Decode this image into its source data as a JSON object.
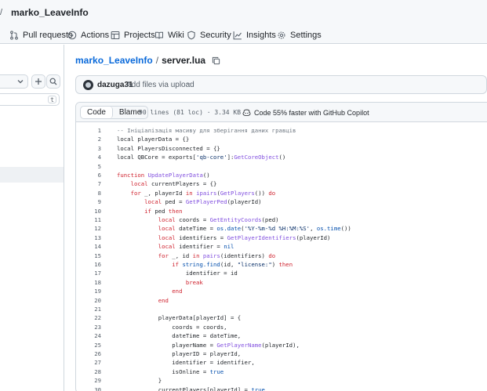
{
  "header": {
    "owner_sep": "/",
    "repo_name": "marko_LeaveInfo"
  },
  "nav": {
    "tabs": [
      {
        "label": "Pull requests",
        "icon": "pull-request-icon"
      },
      {
        "label": "Actions",
        "icon": "play-icon"
      },
      {
        "label": "Projects",
        "icon": "table-icon"
      },
      {
        "label": "Wiki",
        "icon": "book-icon"
      },
      {
        "label": "Security",
        "icon": "shield-icon"
      },
      {
        "label": "Insights",
        "icon": "graph-icon"
      },
      {
        "label": "Settings",
        "icon": "gear-icon"
      }
    ]
  },
  "sidebar": {
    "filter_shortcut": "t"
  },
  "breadcrumb": {
    "repo": "marko_LeaveInfo",
    "sep": "/",
    "file": "server.lua"
  },
  "commit": {
    "author": "dazuga31",
    "message": "Add files via upload",
    "more": "···"
  },
  "file": {
    "code_tab": "Code",
    "blame_tab": "Blame",
    "info": "90 lines (81 loc) · 3.34 KB",
    "copilot": "Code 55% faster with GitHub Copilot"
  },
  "code_lines": [
    {
      "n": "1",
      "segs": [
        [
          "c",
          "-- Ініціалізація масиву для зберігання даних гравців"
        ]
      ]
    },
    {
      "n": "2",
      "segs": [
        [
          "",
          "local playerData = {}"
        ]
      ]
    },
    {
      "n": "3",
      "segs": [
        [
          "",
          "local PlayersDisconnected = {}"
        ]
      ]
    },
    {
      "n": "4",
      "segs": [
        [
          "",
          "local QBCore = exports["
        ],
        [
          "s",
          "'qb-core'"
        ],
        [
          "",
          "]:"
        ],
        [
          "f",
          "GetCoreObject"
        ],
        [
          "",
          "()"
        ]
      ]
    },
    {
      "n": "5",
      "segs": []
    },
    {
      "n": "6",
      "segs": [
        [
          "k",
          "function"
        ],
        [
          "",
          " "
        ],
        [
          "f",
          "UpdatePlayerData"
        ],
        [
          "",
          "()"
        ]
      ]
    },
    {
      "n": "7",
      "segs": [
        [
          "k",
          "    local"
        ],
        [
          "",
          " currentPlayers = {}"
        ]
      ]
    },
    {
      "n": "8",
      "segs": [
        [
          "k",
          "    for"
        ],
        [
          "",
          " _, playerId "
        ],
        [
          "k",
          "in"
        ],
        [
          "",
          " "
        ],
        [
          "f",
          "ipairs"
        ],
        [
          "",
          "("
        ],
        [
          "f",
          "GetPlayers"
        ],
        [
          "",
          "()) "
        ],
        [
          "k",
          "do"
        ]
      ]
    },
    {
      "n": "9",
      "segs": [
        [
          "k",
          "        local"
        ],
        [
          "",
          " ped = "
        ],
        [
          "f",
          "GetPlayerPed"
        ],
        [
          "",
          "(playerId)"
        ]
      ]
    },
    {
      "n": "10",
      "segs": [
        [
          "k",
          "        if"
        ],
        [
          "",
          " ped "
        ],
        [
          "k",
          "then"
        ]
      ]
    },
    {
      "n": "11",
      "segs": [
        [
          "k",
          "            local"
        ],
        [
          "",
          " coords = "
        ],
        [
          "f",
          "GetEntityCoords"
        ],
        [
          "",
          "(ped)"
        ]
      ]
    },
    {
      "n": "12",
      "segs": [
        [
          "k",
          "            local"
        ],
        [
          "",
          " dateTime = "
        ],
        [
          "n",
          "os.date"
        ],
        [
          "",
          "("
        ],
        [
          "s",
          "'%Y-%m-%d %H:%M:%S'"
        ],
        [
          "",
          ", "
        ],
        [
          "n",
          "os.time"
        ],
        [
          "",
          "())"
        ]
      ]
    },
    {
      "n": "13",
      "segs": [
        [
          "k",
          "            local"
        ],
        [
          "",
          " identifiers = "
        ],
        [
          "f",
          "GetPlayerIdentifiers"
        ],
        [
          "",
          "(playerId)"
        ]
      ]
    },
    {
      "n": "14",
      "segs": [
        [
          "k",
          "            local"
        ],
        [
          "",
          " identifier = "
        ],
        [
          "n",
          "nil"
        ]
      ]
    },
    {
      "n": "15",
      "segs": [
        [
          "k",
          "            for"
        ],
        [
          "",
          " _, id "
        ],
        [
          "k",
          "in"
        ],
        [
          "",
          " "
        ],
        [
          "f",
          "pairs"
        ],
        [
          "",
          "(identifiers) "
        ],
        [
          "k",
          "do"
        ]
      ]
    },
    {
      "n": "16",
      "segs": [
        [
          "k",
          "                if"
        ],
        [
          "",
          " "
        ],
        [
          "n",
          "string.find"
        ],
        [
          "",
          "(id, "
        ],
        [
          "s",
          "\"license:\""
        ],
        [
          "",
          ") "
        ],
        [
          "k",
          "then"
        ]
      ]
    },
    {
      "n": "17",
      "segs": [
        [
          "",
          "                    identifier = id"
        ]
      ]
    },
    {
      "n": "18",
      "segs": [
        [
          "k",
          "                    break"
        ]
      ]
    },
    {
      "n": "19",
      "segs": [
        [
          "k",
          "                end"
        ]
      ]
    },
    {
      "n": "20",
      "segs": [
        [
          "k",
          "            end"
        ]
      ]
    },
    {
      "n": "21",
      "segs": []
    },
    {
      "n": "22",
      "segs": [
        [
          "",
          "            playerData[playerId] = {"
        ]
      ]
    },
    {
      "n": "23",
      "segs": [
        [
          "",
          "                coords = coords,"
        ]
      ]
    },
    {
      "n": "24",
      "segs": [
        [
          "",
          "                dateTime = dateTime,"
        ]
      ]
    },
    {
      "n": "25",
      "segs": [
        [
          "",
          "                playerName = "
        ],
        [
          "f",
          "GetPlayerName"
        ],
        [
          "",
          "(playerId),"
        ]
      ]
    },
    {
      "n": "26",
      "segs": [
        [
          "",
          "                playerID = playerId,"
        ]
      ]
    },
    {
      "n": "27",
      "segs": [
        [
          "",
          "                identifier = identifier,"
        ]
      ]
    },
    {
      "n": "28",
      "segs": [
        [
          "",
          "                isOnline = "
        ],
        [
          "n",
          "true"
        ]
      ]
    },
    {
      "n": "29",
      "segs": [
        [
          "",
          "            }"
        ]
      ]
    },
    {
      "n": "30",
      "segs": [
        [
          "",
          "            currentPlayers[playerId] = "
        ],
        [
          "n",
          "true"
        ]
      ]
    }
  ]
}
